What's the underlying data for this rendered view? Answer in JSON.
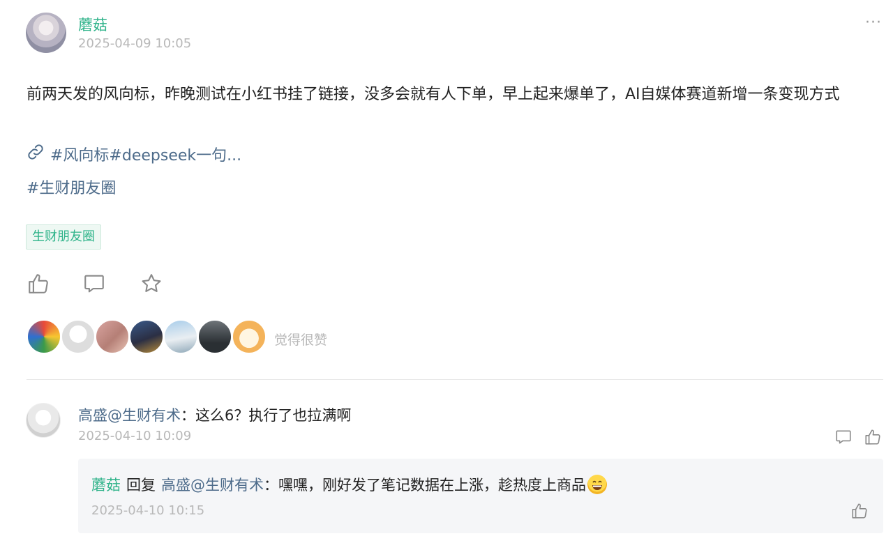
{
  "post": {
    "author": "蘑菇",
    "time": "2025-04-09 10:05",
    "more": "···",
    "body": "前两天发的风向标，昨晚测试在小红书挂了链接，没多会就有人下单，早上起来爆单了，AI自媒体赛道新增一条变现方式",
    "link_text": "#风向标#deepseek一句...",
    "hashtag": "#生财朋友圈",
    "topic_tag": "生财朋友圈",
    "likes_caption": "觉得很赞"
  },
  "comment": {
    "author": "高盛@生财有术",
    "separator": "：",
    "text": "这么6？执行了也拉满啊",
    "time": "2025-04-10 10:09"
  },
  "reply": {
    "author": "蘑菇",
    "reply_word": "回复",
    "target": "高盛@生财有术",
    "separator": "：",
    "text": "嘿嘿，刚好发了笔记数据在上涨，趁热度上商品",
    "time": "2025-04-10 10:15"
  },
  "colors": {
    "accent_green": "#2fb38a",
    "link_blue": "#4d6b8a",
    "muted_gray": "#b8b8b8"
  },
  "icons": {
    "like": "thumbs-up-icon",
    "comment": "chat-bubble-icon",
    "favorite": "star-icon",
    "link": "link-icon",
    "more": "ellipsis-icon"
  }
}
